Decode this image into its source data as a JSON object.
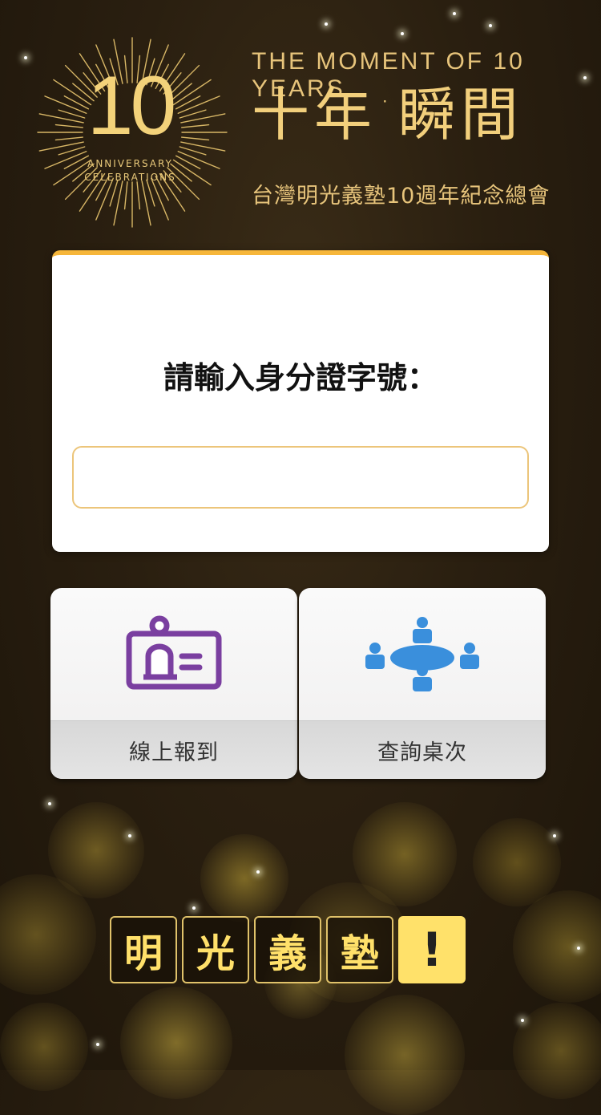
{
  "header": {
    "emblem_number": "10",
    "emblem_line1": "ANNIVERSARY",
    "emblem_line2": "CELEBRATIONS",
    "tagline": "THE MOMENT OF 10 YEARS",
    "title_part1": "十年",
    "title_separator": "·",
    "title_part2": "瞬間",
    "subtitle": "台灣明光義塾10週年紀念總會"
  },
  "form": {
    "prompt": "請輸入身分證字號：",
    "id_value": "",
    "id_placeholder": ""
  },
  "actions": {
    "checkin_label": "線上報到",
    "checkin_icon": "id-card-icon",
    "table_label": "查詢桌次",
    "table_icon": "meeting-table-icon"
  },
  "logo": {
    "chars": [
      "明",
      "光",
      "義",
      "塾"
    ],
    "exclaim": "!"
  },
  "colors": {
    "gold": "#f2cf7c",
    "accent_orange": "#f6b63a",
    "checkin_icon": "#7a3fa0",
    "table_icon": "#3a8fdc",
    "logo_yellow": "#ffe16a"
  }
}
